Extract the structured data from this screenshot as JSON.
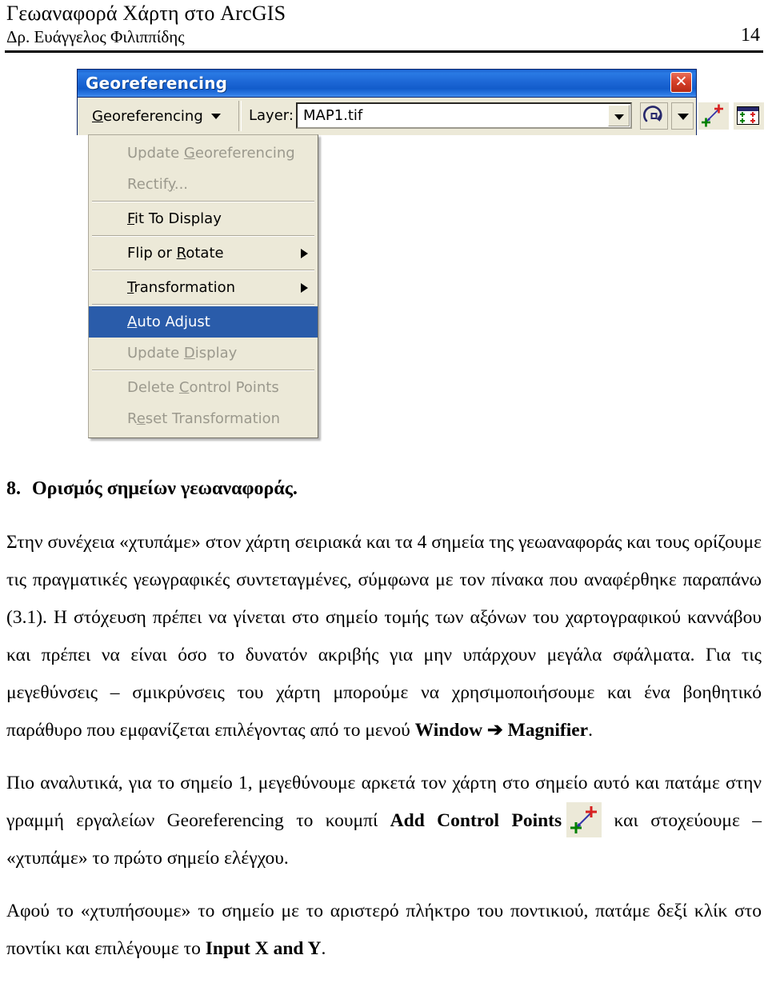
{
  "document": {
    "title": "Γεωαναφορά Χάρτη στο ArcGIS",
    "author": "Δρ. Ευάγγελος Φιλιππίδης",
    "page_number": "14"
  },
  "georeferencing_window": {
    "title": "Georeferencing",
    "close_label": "✕",
    "toolbar": {
      "menu_button": {
        "label_before": "G",
        "accel": "G",
        "label_after": "eoreferencing",
        "full_label": "Georeferencing"
      },
      "layer_label": "Layer:",
      "layer_value": "MAP1.tif",
      "tools": [
        {
          "name": "rotate-tool",
          "tooltip": "Rotate"
        },
        {
          "name": "rotate-dropdown",
          "tooltip": "Rotate options"
        },
        {
          "name": "add-control-points-tool",
          "tooltip": "Add Control Points"
        },
        {
          "name": "view-link-table-tool",
          "tooltip": "View Link Table"
        }
      ]
    },
    "menu": {
      "items": [
        {
          "label": "Update Georeferencing",
          "accel": "G",
          "state": "disabled",
          "submenu": false
        },
        {
          "label": "Rectify...",
          "accel": "y",
          "state": "disabled",
          "submenu": false
        },
        {
          "separator_after": true
        },
        {
          "label": "Fit To Display",
          "accel": "F",
          "state": "enabled",
          "submenu": false
        },
        {
          "separator_after": true
        },
        {
          "label": "Flip or Rotate",
          "accel": "R",
          "state": "enabled",
          "submenu": true
        },
        {
          "separator_after": true
        },
        {
          "label": "Transformation",
          "accel": "T",
          "state": "enabled",
          "submenu": true
        },
        {
          "separator_after": true
        },
        {
          "label": "Auto Adjust",
          "accel": "A",
          "state": "selected",
          "submenu": false
        },
        {
          "label": "Update Display",
          "accel": "D",
          "state": "disabled",
          "submenu": false
        },
        {
          "separator_after": true
        },
        {
          "label": "Delete Control Points",
          "accel": "C",
          "state": "disabled",
          "submenu": false
        },
        {
          "label": "Reset Transformation",
          "accel": "e",
          "state": "disabled",
          "submenu": false
        }
      ]
    }
  },
  "content": {
    "heading_number": "8.",
    "heading_text": "Ορισμός σημείων γεωαναφοράς.",
    "paragraph_1_a": "Στην συνέχεια «χτυπάμε» στον χάρτη σειριακά και τα 4 σημεία της γεωαναφοράς και τους ορίζουμε τις πραγματικές γεωγραφικές συντεταγμένες, σύμφωνα με τον πίνακα που αναφέρθηκε παραπάνω (3.1). Η στόχευση πρέπει να γίνεται στο σημείο τομής των αξόνων του χαρτογραφικού καννάβου και πρέπει να είναι όσο το δυνατόν ακριβής για μην υπάρχουν μεγάλα σφάλματα. Για τις μεγεθύνσεις – σμικρύνσεις του χάρτη μπορούμε να χρησιμοποιήσουμε και ένα βοηθητικό παράθυρο που εμφανίζεται επιλέγοντας από το μενού ",
    "paragraph_1_bold_1": "Window",
    "paragraph_1_arrow": " ➔ ",
    "paragraph_1_bold_2": "Magnifier",
    "paragraph_1_end": ".",
    "paragraph_2_a": "Πιο αναλυτικά, για το σημείο 1, μεγεθύνουμε αρκετά τον χάρτη στο σημείο αυτό και πατάμε στην γραμμή εργαλείων Georeferencing το κουμπί ",
    "paragraph_2_bold": "Add Control Points",
    "paragraph_2_b": " και στοχεύουμε – «χτυπάμε» το πρώτο σημείο ελέγχου.",
    "paragraph_3_a": "Αφού το «χτυπήσουμε» το σημείο με το αριστερό πλήκτρο του ποντικιού, πατάμε δεξί κλίκ στο ποντίκι και επιλέγουμε το ",
    "paragraph_3_bold": "Input X and Y",
    "paragraph_3_end": "."
  },
  "colors": {
    "titlebar_blue": "#1f6ad8",
    "menu_highlight": "#2a5caa",
    "toolbar_face": "#ece9d8",
    "disabled_text": "#9b998d",
    "close_red": "#d8412a",
    "cp_green": "#008000",
    "cp_red": "#d82020",
    "cp_arrow_blue": "#3333aa"
  }
}
